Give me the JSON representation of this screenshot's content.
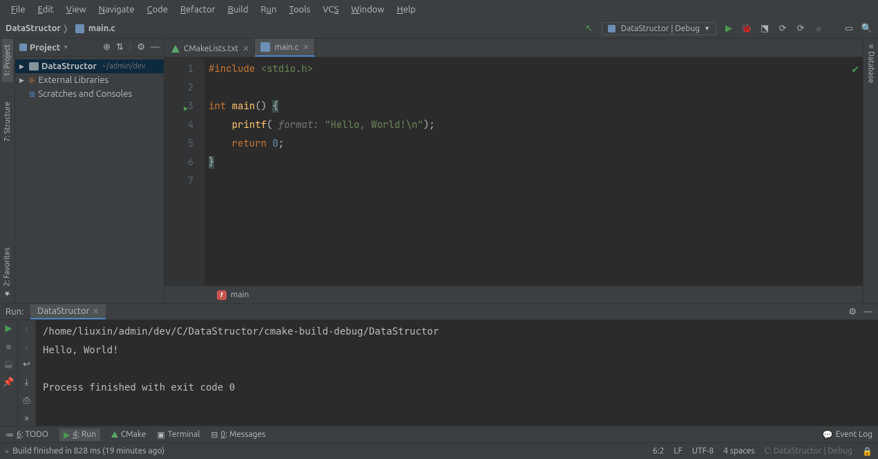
{
  "menu": {
    "items": [
      "File",
      "Edit",
      "View",
      "Navigate",
      "Code",
      "Refactor",
      "Build",
      "Run",
      "Tools",
      "VCS",
      "Window",
      "Help"
    ]
  },
  "breadcrumb": {
    "project": "DataStructor",
    "file": "main.c"
  },
  "run_config": {
    "label": "DataStructor | Debug"
  },
  "left_tools": {
    "project": "1: Project",
    "structure": "7: Structure",
    "favorites": "2: Favorites"
  },
  "right_tools": {
    "database": "Database"
  },
  "project_panel": {
    "title": "Project",
    "items": [
      {
        "label": "DataStructor",
        "path": "~/admin/dev"
      },
      {
        "label": "External Libraries"
      },
      {
        "label": "Scratches and Consoles"
      }
    ]
  },
  "editor": {
    "tabs": [
      {
        "label": "CMakeLists.txt",
        "active": false
      },
      {
        "label": "main.c",
        "active": true
      }
    ],
    "lines": [
      "1",
      "2",
      "3",
      "4",
      "5",
      "6",
      "7"
    ],
    "code": {
      "include_kw": "#include",
      "include_hdr": "<stdio.h>",
      "int_kw": "int",
      "main_fn": "main",
      "printf_fn": "printf",
      "hint": "format:",
      "str": "\"Hello, World!\\n\"",
      "return_kw": "return",
      "zero": "0"
    },
    "crumb": "main"
  },
  "run": {
    "title": "Run:",
    "tab": "DataStructor",
    "output": [
      "/home/liuxin/admin/dev/C/DataStructor/cmake-build-debug/DataStructor",
      "Hello, World!",
      "",
      "Process finished with exit code 0"
    ]
  },
  "bottom_tools": {
    "todo": "6: TODO",
    "run": "4: Run",
    "cmake": "CMake",
    "terminal": "Terminal",
    "messages": "0: Messages",
    "event_log": "Event Log"
  },
  "status": {
    "message": "Build finished in 828 ms (19 minutes ago)",
    "pos": "6:2",
    "le": "LF",
    "enc": "UTF-8",
    "indent": "4 spaces",
    "context": "C: DataStructor | Debug"
  }
}
